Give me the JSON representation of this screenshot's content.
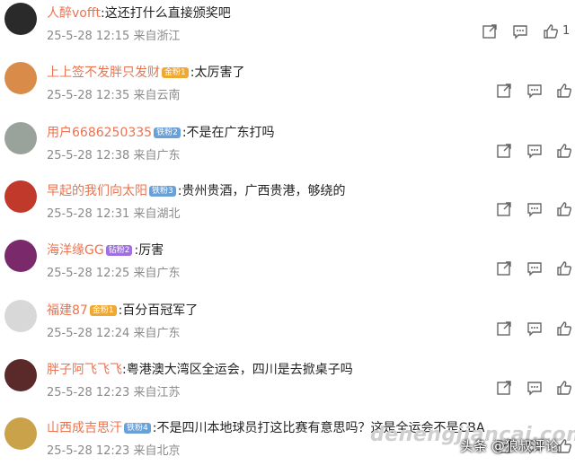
{
  "comments": [
    {
      "user": "人醉vofft",
      "badge": "",
      "text": ":这还打什么直接颁奖吧",
      "time": "25-5-28 12:15",
      "from": "来自浙江",
      "likes": "1"
    },
    {
      "user": "上上签不发胖只发财",
      "badge": "金粉1",
      "text": ":太厉害了",
      "time": "25-5-28 12:35",
      "from": "来自云南",
      "likes": ""
    },
    {
      "user": "用户6686250335",
      "badge": "铁粉2",
      "text": ":不是在广东打吗",
      "time": "25-5-28 12:38",
      "from": "来自广东",
      "likes": ""
    },
    {
      "user": "早起的我们向太阳",
      "badge": "铁粉3",
      "text": ":贵州贵酒，广西贵港，够绕的",
      "time": "25-5-28 12:31",
      "from": "来自湖北",
      "likes": ""
    },
    {
      "user": "海洋缘GG",
      "badge": "钻粉2",
      "text": ":厉害",
      "time": "25-5-28 12:25",
      "from": "来自广东",
      "likes": ""
    },
    {
      "user": "福建87",
      "badge": "金粉1",
      "text": ":百分百冠军了",
      "time": "25-5-28 12:24",
      "from": "来自广东",
      "likes": ""
    },
    {
      "user": "胖子阿飞飞飞",
      "badge": "",
      "text": ":粤港澳大湾区全运会，四川是去掀桌子吗",
      "time": "25-5-28 12:23",
      "from": "来自江苏",
      "likes": ""
    },
    {
      "user": "山西成吉思汗",
      "badge": "铁粉4",
      "text": ":不是四川本地球员打这比赛有意思吗？这是全运会不是CBA",
      "time": "25-5-28 12:23",
      "from": "来自北京",
      "likes": ""
    }
  ],
  "watermark": "denengjiancai.com",
  "source_label": "头条 @狼叔评论",
  "icons": {
    "share": "share-icon",
    "comment": "comment-icon",
    "like": "thumbs-up-icon"
  }
}
